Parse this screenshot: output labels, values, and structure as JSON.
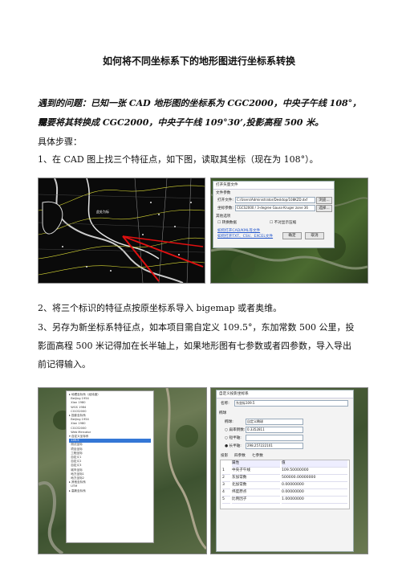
{
  "title": "如何将不同坐标系下的地形图进行坐标系转换",
  "problem_line1": "遇到的问题：已知一张 CAD 地形图的坐标系为 CGC2000，中央子午线 108°，现",
  "problem_line2": "需要将其转换成 CGC2000，中央子午线 109°30’,投影高程 500 米。",
  "steps_heading": "具体步骤：",
  "step1": "1、在 CAD 图上找三个特征点，如下图，读取其坐标（现在为 108°）。",
  "step2": "2、将三个标识的特征点按原坐标系导入 bigemap 或者奥维。",
  "step3_line1": "3、另存为新坐标系特征点，如本项目需自定义 109.5°，东加常数 500 公里，投",
  "step3_line2": "影面高程 500 米记得加在长半轴上，如果地形图有七参数或者四参数，导入导出",
  "step3_line3": "前记得输入。",
  "cad_label": "此处为标",
  "dialog1": {
    "title": "打开矢量文件",
    "group": "文件参数",
    "open_label": "打开文件:",
    "open_path": "C:/Users/Administrator/Desktop/108KZD.dxf",
    "browse": "浏览...",
    "coord_label": "坐标参数:",
    "coord_value": "CGCS2000 / 3-degree Gauss-Kruger zone 36",
    "select": "选择...",
    "group2": "其他选项",
    "chk1": "转换数据",
    "chk2": "不对显示压缩",
    "link1": "如何打开CAD/KML等文件",
    "link2": "如何打开TXT、CSV、EXCEL文件",
    "ok": "确定",
    "cancel": "取消"
  },
  "tree_items": [
    "▸ 地理坐标系（经纬度）",
    "  Beijing 1954",
    "  Xian 1980",
    "  WGS 1984",
    "  CGCS2000",
    "▸ 投影坐标系",
    "  Beijing 1954",
    "  Xian 1980",
    "  CGCS2000",
    "  Web Mercator",
    "▾ 自定义坐标系",
    "  109.5",
    "  测试坐标",
    "  项目坐标",
    "  工程坐标",
    "  自定义1",
    "  自定义2",
    "  自定义3",
    "  城市坐标",
    "  地方坐标1",
    "  地方坐标2",
    "▸ 其他坐标系",
    "  UTM",
    "▸ 高斯坐标系"
  ],
  "tree_selected_index": 11,
  "dialog2": {
    "title": "自定义投影坐标系",
    "name_label": "名称:",
    "name_value": "东坐标109.5",
    "group": "椭球",
    "ellipsoid_label": "椭球:",
    "ellipsoid_value": "自定义椭球",
    "flattening_label": "扁率倒数:",
    "flattening_value": "0.3352811",
    "minor_label": "短半轴:",
    "major_label": "长半轴:",
    "major_value": "298.257222101",
    "tabs": [
      "投影",
      "四参数",
      "七参数"
    ],
    "col1": "属性",
    "col2": "值",
    "params": [
      {
        "k": "中央子午线",
        "v": "109.50000000"
      },
      {
        "k": "东加常数",
        "v": "500000.00000000"
      },
      {
        "k": "北加常数",
        "v": "0.00000000"
      },
      {
        "k": "纬度原点",
        "v": "0.00000000"
      },
      {
        "k": "比例因子",
        "v": "1.00000000"
      }
    ]
  }
}
